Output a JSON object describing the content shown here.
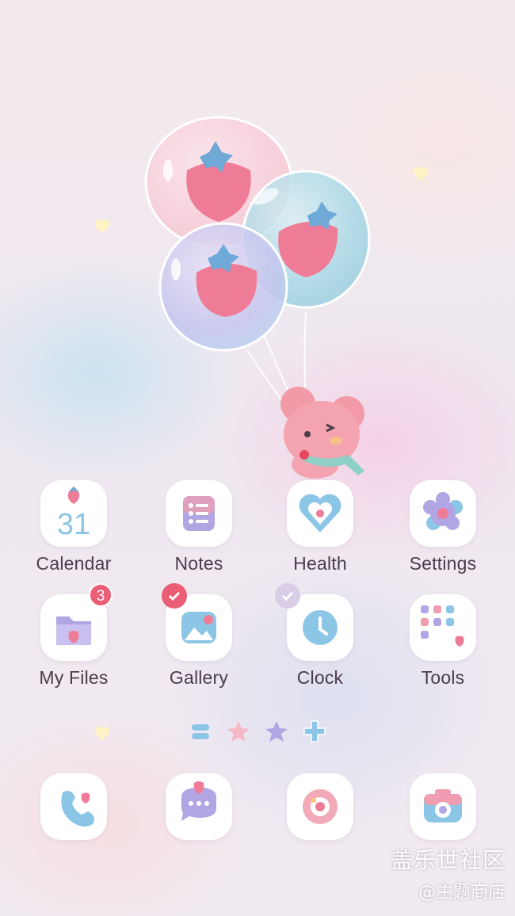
{
  "apps_row1": [
    {
      "label": "Calendar",
      "icon": "calendar-icon",
      "date_text": "31"
    },
    {
      "label": "Notes",
      "icon": "notes-icon"
    },
    {
      "label": "Health",
      "icon": "health-icon"
    },
    {
      "label": "Settings",
      "icon": "settings-icon"
    }
  ],
  "apps_row2": [
    {
      "label": "My Files",
      "icon": "folder-icon",
      "badge": "3"
    },
    {
      "label": "Gallery",
      "icon": "gallery-icon"
    },
    {
      "label": "Clock",
      "icon": "clock-icon"
    },
    {
      "label": "Tools",
      "icon": "tools-folder-icon"
    }
  ],
  "page_indicator": {
    "pages": 4,
    "current_page": 1
  },
  "dock": [
    {
      "icon": "phone-icon"
    },
    {
      "icon": "messages-icon"
    },
    {
      "icon": "internet-icon"
    },
    {
      "icon": "camera-icon"
    }
  ],
  "watermark": {
    "main": "盖乐世社区",
    "sub": "@主题商店"
  },
  "colors": {
    "label": "#4a3d4a",
    "badge": "#ea5d74",
    "strawberry": "#ef7c97",
    "blue": "#8cc6e6",
    "lilac": "#b2a5e3"
  }
}
